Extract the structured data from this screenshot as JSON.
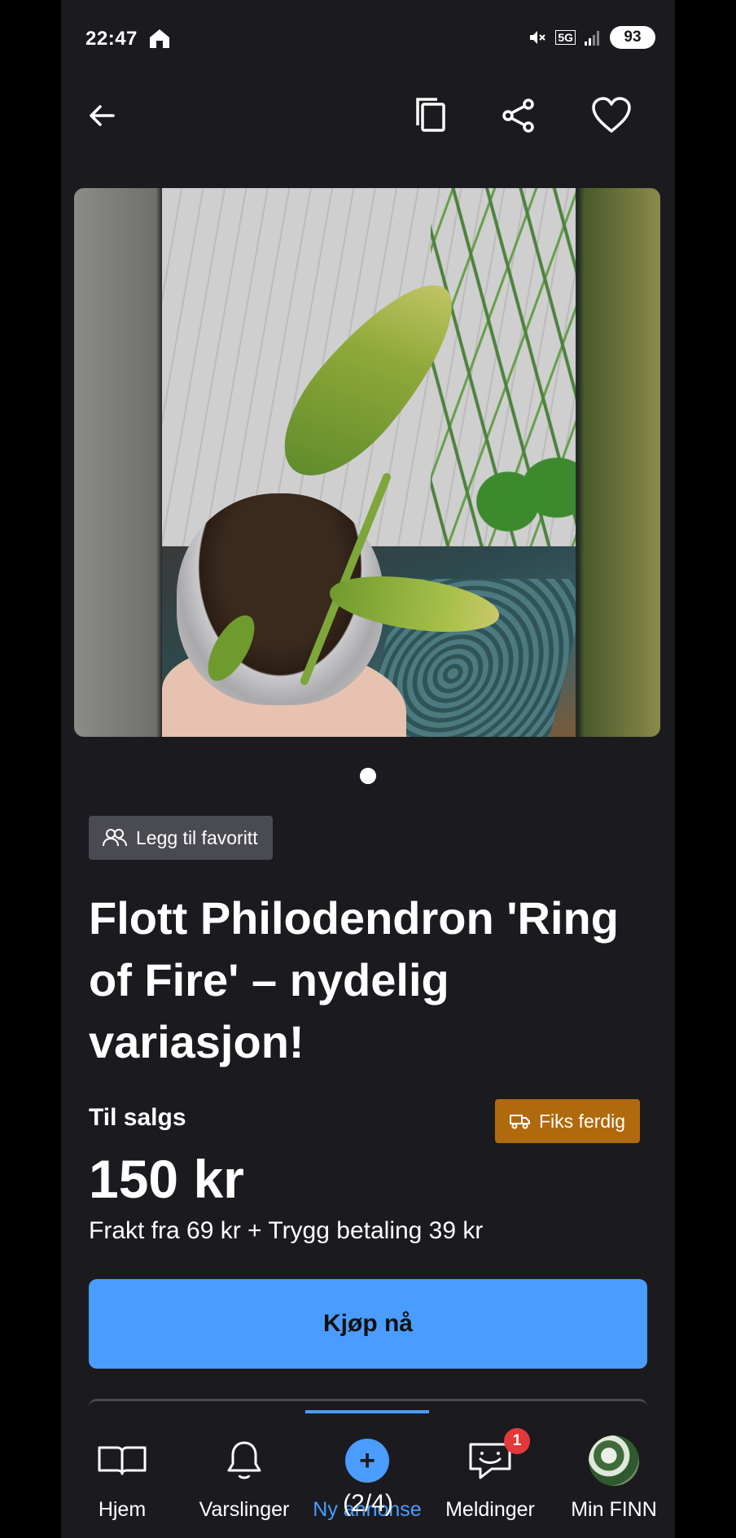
{
  "status_bar": {
    "time": "22:47",
    "network": "5G",
    "battery": "93"
  },
  "listing": {
    "photo_count": 1,
    "current_photo": 1,
    "favorite_chip": "Legg til favoritt",
    "title": "Flott Philodendron 'Ring of Fire' – nydelig variasjon!",
    "sale_type": "Til salgs",
    "shipping_badge": "Fiks ferdig",
    "price": "150 kr",
    "shipping_info": "Frakt fra 69 kr + Trygg betaling 39 kr",
    "buy_button": "Kjøp nå"
  },
  "bottom_nav": {
    "items": [
      {
        "label": "Hjem",
        "icon": "book-open-icon"
      },
      {
        "label": "Varslinger",
        "icon": "bell-icon"
      },
      {
        "label": "Ny annonse",
        "icon": "plus-circle-icon"
      },
      {
        "label": "Meldinger",
        "icon": "chat-bubble-icon",
        "badge": "1"
      },
      {
        "label": "Min FINN",
        "icon": "avatar"
      }
    ]
  },
  "page_counter": "(2/4)",
  "colors": {
    "background": "#1b1b1f",
    "accent": "#4a9dff",
    "chip": "#4a4b52",
    "shipping_badge": "#b0690d",
    "badge_red": "#e5383b"
  }
}
